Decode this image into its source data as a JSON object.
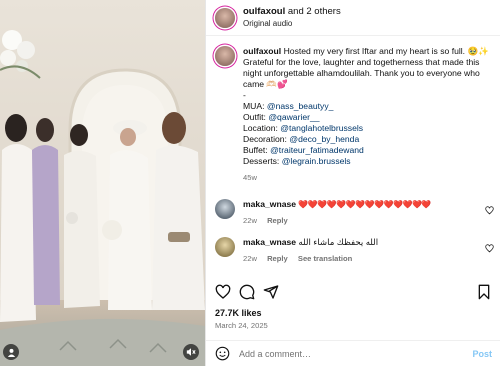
{
  "header": {
    "username": "oulfaxoul",
    "collab_text": " and 2 others",
    "audio": "Original audio"
  },
  "caption": {
    "username": "oulfaxoul",
    "text_1": " Hosted my very first Iftar and my heart is so full. 🥹✨ Grateful for the love, laughter and togetherness that made this night unforgettable alhamdoulilah. Thank you to everyone who came 🫶🏻💕",
    "dash": "-",
    "mua_label": "MUA: ",
    "mua_handle": "@nass_beautyy_",
    "outfit_label": "Outfit: ",
    "outfit_handle": "@qawarier__",
    "location_label": "Location: ",
    "location_handle": "@tanglahotelbrussels",
    "decoration_label": "Decoration: ",
    "decoration_handle": "@deco_by_henda",
    "buffet_label": "Buffet: ",
    "buffet_handle": "@traiteur_fatimadewand",
    "desserts_label": "Desserts: ",
    "desserts_handle": "@legrain.brussels",
    "time": "45w"
  },
  "comments": [
    {
      "username": "maka_wnase",
      "text": "❤️❤️❤️❤️❤️❤️❤️❤️❤️❤️❤️❤️❤️❤️",
      "time": "22w",
      "reply": "Reply",
      "translate": ""
    },
    {
      "username": "maka_wnase",
      "text": "الله يحفظك ماشاء الله",
      "time": "22w",
      "reply": "Reply",
      "translate": "See translation"
    }
  ],
  "stats": {
    "likes": "27.7K likes",
    "date": "March 24, 2025"
  },
  "composer": {
    "placeholder": "Add a comment…",
    "post": "Post"
  },
  "icons": [
    "heart-icon",
    "comment-icon",
    "share-icon",
    "bookmark-icon",
    "emoji-icon",
    "user-tag-icon",
    "mute-icon"
  ],
  "colors": {
    "link": "#00376b",
    "secondary": "#737373",
    "post_disabled": "#85c7f5",
    "heart_red": "#ed2939"
  }
}
